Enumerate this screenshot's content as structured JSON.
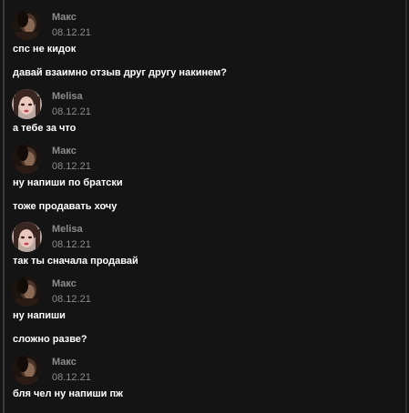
{
  "colors": {
    "background": "#141414",
    "author_text": "#8c8c8c",
    "message_text": "#ffffff"
  },
  "messages": [
    {
      "author": "Макс",
      "date": "08.12.21",
      "avatar_icon": "dark-portrait-avatar",
      "lines": [
        "спс не кидок",
        "давай взаимно отзыв друг другу накинем?"
      ]
    },
    {
      "author": "Melisa",
      "date": "08.12.21",
      "avatar_icon": "light-portrait-avatar",
      "lines": [
        "а тебе за что"
      ]
    },
    {
      "author": "Макс",
      "date": "08.12.21",
      "avatar_icon": "dark-portrait-avatar",
      "lines": [
        "ну напиши по братски",
        "тоже продавать хочу"
      ]
    },
    {
      "author": "Melisa",
      "date": "08.12.21",
      "avatar_icon": "light-portrait-avatar",
      "lines": [
        "так ты сначала продавай"
      ]
    },
    {
      "author": "Макс",
      "date": "08.12.21",
      "avatar_icon": "dark-portrait-avatar",
      "lines": [
        "ну напиши",
        "сложно разве?"
      ]
    },
    {
      "author": "Макс",
      "date": "08.12.21",
      "avatar_icon": "dark-portrait-avatar",
      "lines": [
        "бля чел ну напиши пж"
      ]
    }
  ]
}
